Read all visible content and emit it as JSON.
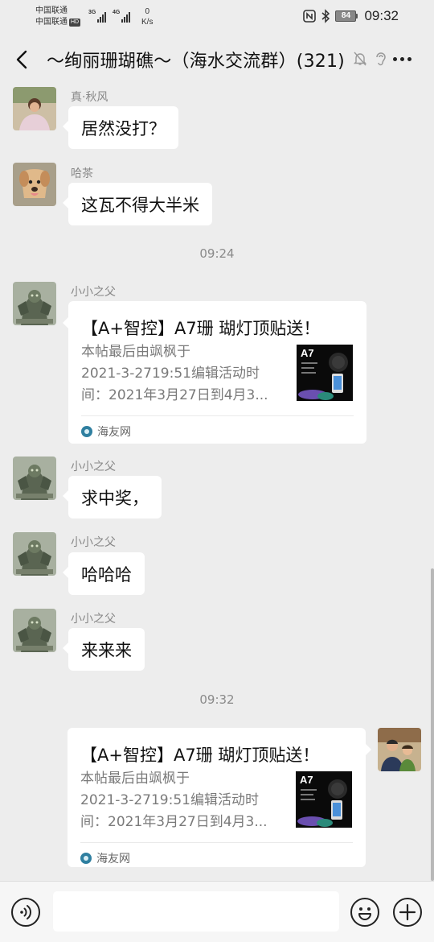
{
  "status_bar": {
    "carrier_1": "中国联通",
    "carrier_2": "中国联通",
    "hd_badge": "HD",
    "signal_1_label": "3G",
    "signal_2_label": "4G",
    "net_speed_value": "0",
    "net_speed_unit": "K/s",
    "battery": "84",
    "time": "09:32"
  },
  "header": {
    "title": "～绚丽珊瑚礁～（海水交流群）(321)"
  },
  "messages": [
    {
      "sender": "真·秋风",
      "text": "居然没打？"
    },
    {
      "sender": "哈茶",
      "text": "这瓦不得大半米"
    },
    {
      "timestamp": "09:24"
    },
    {
      "sender": "小小之父",
      "card": {
        "title": "【A+智控】A7珊 瑚灯顶贴送！",
        "desc_lines": [
          "本帖最后由飒枫于",
          "2021-3-2719:51编辑活动时",
          "间：2021年3月27日到4月3..."
        ],
        "source": "海友网",
        "thumb_label": "A7"
      }
    },
    {
      "sender": "小小之父",
      "text": "求中奖，"
    },
    {
      "sender": "小小之父",
      "text": "哈哈哈"
    },
    {
      "sender": "小小之父",
      "text": "来来来"
    },
    {
      "timestamp": "09:32"
    },
    {
      "self": true,
      "card": {
        "title": "【A+智控】A7珊 瑚灯顶贴送！",
        "desc_lines": [
          "本帖最后由飒枫于",
          "2021-3-2719:51编辑活动时",
          "间：2021年3月27日到4月3..."
        ],
        "source": "海友网",
        "thumb_label": "A7"
      }
    }
  ],
  "input_bar": {
    "placeholder": ""
  },
  "colors": {
    "background": "#ededed",
    "bubble": "#ffffff",
    "link_source_icon": "#2f7fa0"
  }
}
